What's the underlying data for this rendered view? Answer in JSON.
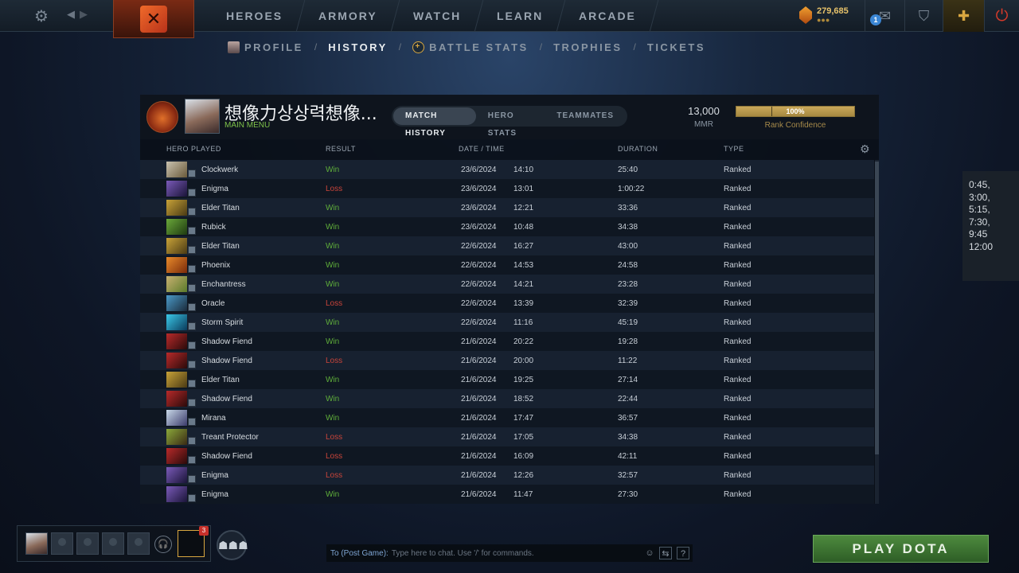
{
  "topbar": {
    "nav": [
      "HEROES",
      "ARMORY",
      "WATCH",
      "LEARN",
      "ARCADE"
    ],
    "currency": "279,685",
    "currency_dots": "●●●",
    "mail_count": "1"
  },
  "subnav": {
    "items": [
      "PROFILE",
      "HISTORY",
      "BATTLE STATS",
      "TROPHIES",
      "TICKETS"
    ],
    "active": "HISTORY"
  },
  "profile": {
    "name": "想像力상상력想像...",
    "status": "MAIN MENU",
    "tabs": [
      "MATCH HISTORY",
      "HERO STATS",
      "TEAMMATES"
    ],
    "mmr_value": "13,000",
    "mmr_label": "MMR",
    "confidence_pct": "100%",
    "confidence_fraction": 1.0,
    "confidence_label": "Rank Confidence"
  },
  "table": {
    "columns": [
      "HERO PLAYED",
      "RESULT",
      "DATE / TIME",
      "DURATION",
      "TYPE"
    ],
    "rows": [
      {
        "hero": "Clockwerk",
        "result": "Win",
        "date": "23/6/2024",
        "time": "14:10",
        "duration": "25:40",
        "type": "Ranked"
      },
      {
        "hero": "Enigma",
        "result": "Loss",
        "date": "23/6/2024",
        "time": "13:01",
        "duration": "1:00:22",
        "type": "Ranked"
      },
      {
        "hero": "Elder Titan",
        "result": "Win",
        "date": "23/6/2024",
        "time": "12:21",
        "duration": "33:36",
        "type": "Ranked"
      },
      {
        "hero": "Rubick",
        "result": "Win",
        "date": "23/6/2024",
        "time": "10:48",
        "duration": "34:38",
        "type": "Ranked"
      },
      {
        "hero": "Elder Titan",
        "result": "Win",
        "date": "22/6/2024",
        "time": "16:27",
        "duration": "43:00",
        "type": "Ranked"
      },
      {
        "hero": "Phoenix",
        "result": "Win",
        "date": "22/6/2024",
        "time": "14:53",
        "duration": "24:58",
        "type": "Ranked"
      },
      {
        "hero": "Enchantress",
        "result": "Win",
        "date": "22/6/2024",
        "time": "14:21",
        "duration": "23:28",
        "type": "Ranked"
      },
      {
        "hero": "Oracle",
        "result": "Loss",
        "date": "22/6/2024",
        "time": "13:39",
        "duration": "32:39",
        "type": "Ranked"
      },
      {
        "hero": "Storm Spirit",
        "result": "Win",
        "date": "22/6/2024",
        "time": "11:16",
        "duration": "45:19",
        "type": "Ranked"
      },
      {
        "hero": "Shadow Fiend",
        "result": "Win",
        "date": "21/6/2024",
        "time": "20:22",
        "duration": "19:28",
        "type": "Ranked"
      },
      {
        "hero": "Shadow Fiend",
        "result": "Loss",
        "date": "21/6/2024",
        "time": "20:00",
        "duration": "11:22",
        "type": "Ranked"
      },
      {
        "hero": "Elder Titan",
        "result": "Win",
        "date": "21/6/2024",
        "time": "19:25",
        "duration": "27:14",
        "type": "Ranked"
      },
      {
        "hero": "Shadow Fiend",
        "result": "Win",
        "date": "21/6/2024",
        "time": "18:52",
        "duration": "22:44",
        "type": "Ranked"
      },
      {
        "hero": "Mirana",
        "result": "Win",
        "date": "21/6/2024",
        "time": "17:47",
        "duration": "36:57",
        "type": "Ranked"
      },
      {
        "hero": "Treant Protector",
        "result": "Loss",
        "date": "21/6/2024",
        "time": "17:05",
        "duration": "34:38",
        "type": "Ranked"
      },
      {
        "hero": "Shadow Fiend",
        "result": "Loss",
        "date": "21/6/2024",
        "time": "16:09",
        "duration": "42:11",
        "type": "Ranked"
      },
      {
        "hero": "Enigma",
        "result": "Loss",
        "date": "21/6/2024",
        "time": "12:26",
        "duration": "32:57",
        "type": "Ranked"
      },
      {
        "hero": "Enigma",
        "result": "Win",
        "date": "21/6/2024",
        "time": "11:47",
        "duration": "27:30",
        "type": "Ranked"
      }
    ]
  },
  "side_note": [
    "0:45,",
    "3:00,",
    "5:15,",
    "7:30,",
    "9:45",
    "12:00"
  ],
  "bottom": {
    "queue_badge": "3",
    "chat_to": "To (Post Game):",
    "chat_placeholder": "Type here to chat. Use '/' for commands.",
    "chat_help": "?",
    "play_label": "PLAY DOTA"
  },
  "colors": {
    "win": "#5fae3a",
    "loss": "#c8443a",
    "play_button": "#3f7a33",
    "gold": "#d9a740"
  },
  "icons": {
    "settings": "gear-icon",
    "back": "chevron-left-icon",
    "forward": "chevron-right-icon",
    "mail": "mail-icon",
    "armory": "armory-icon",
    "plus": "dota-plus-icon",
    "power": "power-icon"
  }
}
